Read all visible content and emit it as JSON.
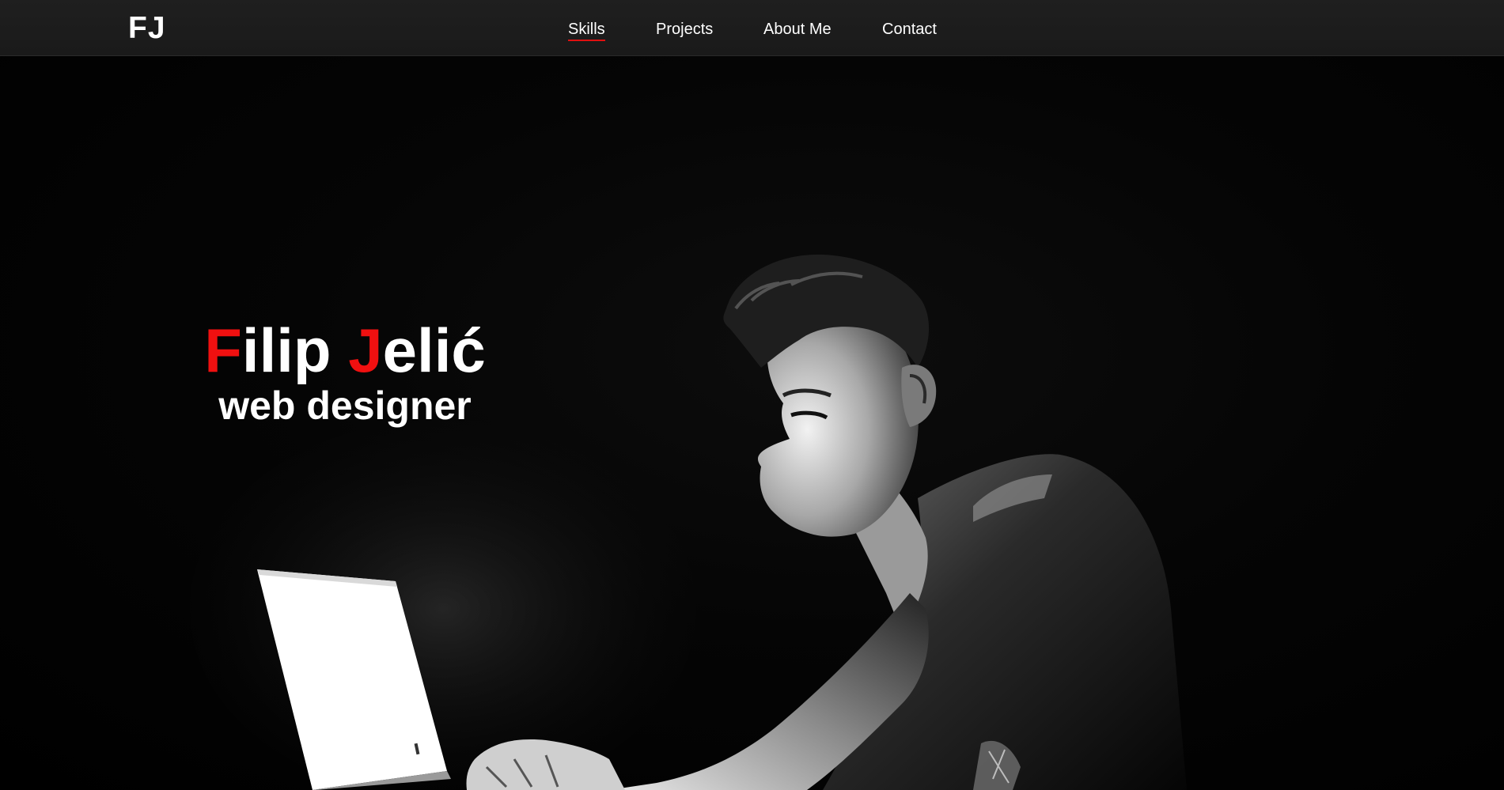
{
  "header": {
    "logo": "FJ",
    "nav": [
      {
        "label": "Skills",
        "active": true
      },
      {
        "label": "Projects",
        "active": false
      },
      {
        "label": "About Me",
        "active": false
      },
      {
        "label": "Contact",
        "active": false
      }
    ]
  },
  "hero": {
    "first_initial": "F",
    "first_rest": "ilip ",
    "last_initial": "J",
    "last_rest": "elić",
    "subtitle": "web designer",
    "image": "man-at-laptop-in-dark-photo"
  },
  "colors": {
    "accent": "#f01010",
    "navbar": "#1d1d1d",
    "background": "#000000",
    "text": "#ffffff"
  }
}
